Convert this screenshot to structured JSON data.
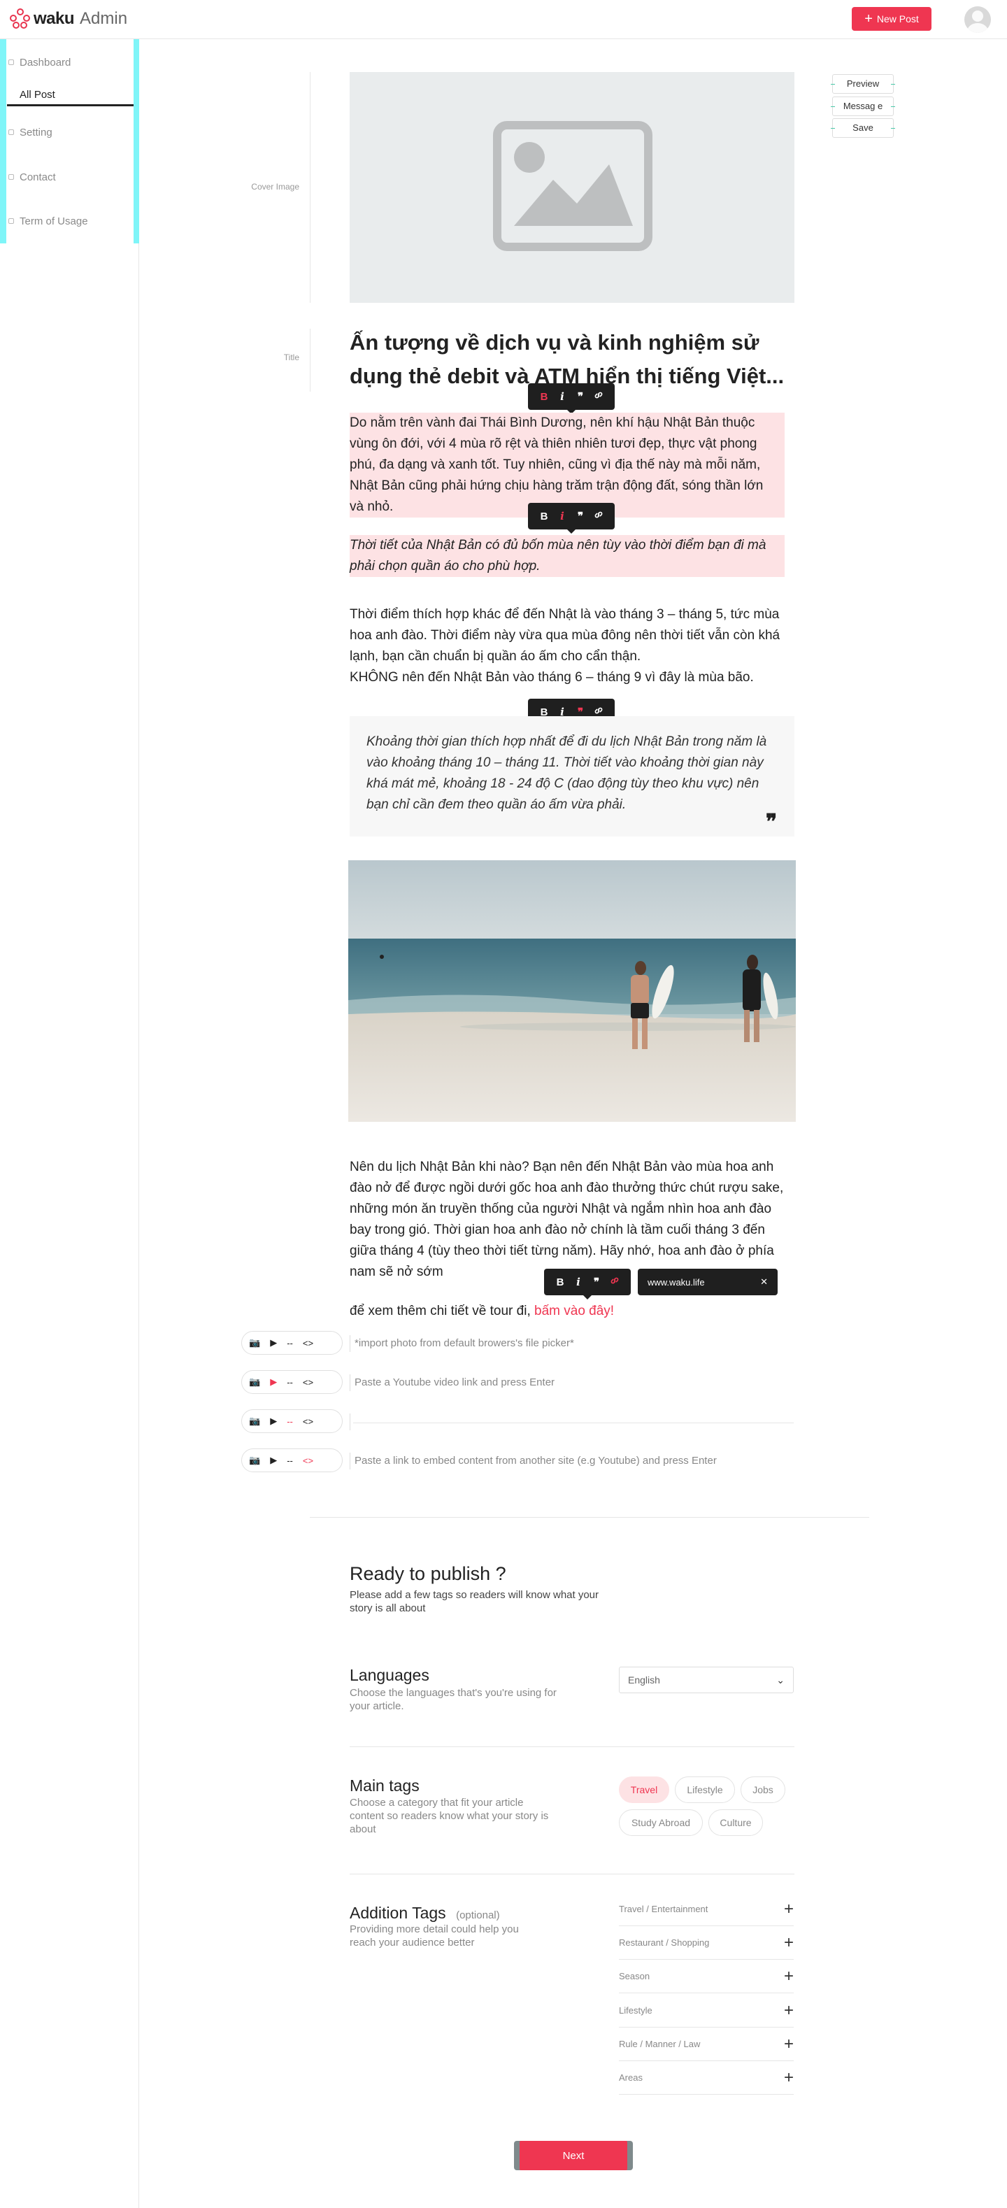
{
  "header": {
    "brand": "waku",
    "section": "Admin",
    "new_post_label": "New Post"
  },
  "sidebar": {
    "items": [
      {
        "label": "Dashboard"
      },
      {
        "label": "All Post"
      },
      {
        "label": "Setting"
      },
      {
        "label": "Contact"
      },
      {
        "label": "Term of Usage"
      }
    ]
  },
  "editor": {
    "cover_label": "Cover Image",
    "title_label": "Title",
    "title": "Ấn tượng về dịch vụ và kinh nghiệm sử dụng thẻ debit và ATM hiển thị tiếng Việt...",
    "side_buttons": {
      "preview": "Preview",
      "message": "Messag e",
      "save": "Save"
    },
    "paragraphs": {
      "p1": "Do nằm trên vành đai Thái Bình Dương, nên khí hậu Nhật Bản thuộc vùng ôn đới, với 4 mùa rõ rệt và thiên nhiên tươi đẹp, thực vật phong phú, đa dạng và xanh tốt. Tuy nhiên, cũng vì địa thế này mà mỗi năm, Nhật Bản cũng phải hứng chịu hàng trăm trận động đất, sóng thần lớn và nhỏ.",
      "p2": "Thời tiết của Nhật Bản có đủ bốn mùa nên tùy vào thời điểm bạn đi mà phải chọn quần áo cho phù hợp.",
      "p3": "Thời điểm thích hợp khác để đến Nhật là vào tháng 3 – tháng 5, tức mùa hoa anh đào. Thời điểm này vừa qua mùa đông nên thời tiết vẫn còn khá lạnh, bạn cần chuẩn bị quần áo ấm cho cẩn thận.",
      "p3b": "KHÔNG nên đến Nhật Bản vào tháng 6 – tháng 9 vì đây là mùa bão.",
      "quote": "Khoảng thời gian thích hợp nhất để đi du lịch Nhật Bản trong năm là vào khoảng tháng 10 – tháng 11. Thời tiết vào khoảng thời gian này khá mát mẻ, khoảng 18 - 24 độ C (dao động tùy theo khu vực) nên bạn chỉ cần đem theo quần áo ấm vừa phải.",
      "p4": "Nên du lịch Nhật Bản khi nào? Bạn nên đến Nhật Bản vào mùa hoa anh đào nở để được ngồi dưới gốc hoa anh đào thưởng thức chút rượu sake, những món ăn truyền thống của người Nhật và ngắm nhìn hoa anh đào bay trong gió. Thời gian hoa anh đào nở chính là tầm cuối tháng 3 đến giữa tháng 4 (tùy theo thời tiết từng năm). Hãy nhớ, hoa anh đào ở phía nam sẽ nở sớm",
      "p5_prefix": "để xem thêm chi tiết về tour đi,",
      "p5_link": "bấm vào đây!"
    },
    "link_popup": {
      "url": "www.waku.life",
      "close": "✕"
    },
    "toolbar": {
      "bold": "B",
      "italic": "i",
      "quote": "❞",
      "link": "🔗"
    },
    "embeds": [
      {
        "hint": "*import photo from default browers's file picker*",
        "dash": "--",
        "code": "<>"
      },
      {
        "hint": "Paste a Youtube video link and press Enter",
        "dash": "--",
        "code": "<>"
      },
      {
        "hint": "",
        "dash": "--",
        "code": "<>"
      },
      {
        "hint": "Paste a link to embed content from another site (e.g Youtube) and press Enter",
        "dash": "--",
        "code": "<>"
      }
    ]
  },
  "publish": {
    "heading": "Ready to publish ?",
    "subtitle": "Please add a few tags so readers will know what your story is all about",
    "languages": {
      "title": "Languages",
      "desc": "Choose the languages that's you're using for your article.",
      "selected": "English"
    },
    "main_tags": {
      "title": "Main tags",
      "desc": "Choose a category that fit your article content so readers know what your story is about",
      "chips": [
        "Travel",
        "Lifestyle",
        "Jobs",
        "Study Abroad",
        "Culture"
      ],
      "selected": "Travel"
    },
    "addition_tags": {
      "title": "Addition Tags",
      "optional": "(optional)",
      "desc": "Providing more detail could help you reach your audience better",
      "rows": [
        "Travel / Entertainment",
        "Restaurant / Shopping",
        "Season",
        "Lifestyle",
        "Rule / Manner / Law",
        "Areas"
      ]
    },
    "next_label": "Next"
  },
  "colors": {
    "accent": "#ef3651",
    "highlight": "#fde2e4",
    "guide": "#7ff5f8"
  }
}
